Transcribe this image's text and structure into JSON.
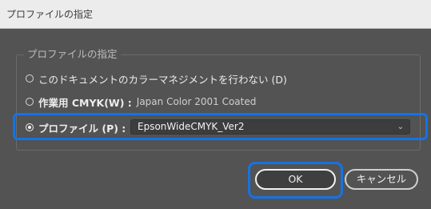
{
  "window": {
    "title": "プロファイルの指定"
  },
  "group": {
    "label": "プロファイルの指定"
  },
  "options": {
    "no_color_management": {
      "label": "このドキュメントのカラーマネジメントを行わない (D)",
      "checked": false
    },
    "working_cmyk": {
      "label": "作業用 CMYK(W) :",
      "value": "Japan Color 2001 Coated",
      "checked": false
    },
    "profile": {
      "label": "プロファイル (P) :",
      "checked": true
    }
  },
  "profile_select": {
    "selected": "EpsonWideCMYK_Ver2"
  },
  "buttons": {
    "ok": "OK",
    "cancel": "キャンセル"
  },
  "colors": {
    "dialog_bg": "#535353",
    "highlight": "#1473e6",
    "titlebar_bg": "#ececec"
  }
}
